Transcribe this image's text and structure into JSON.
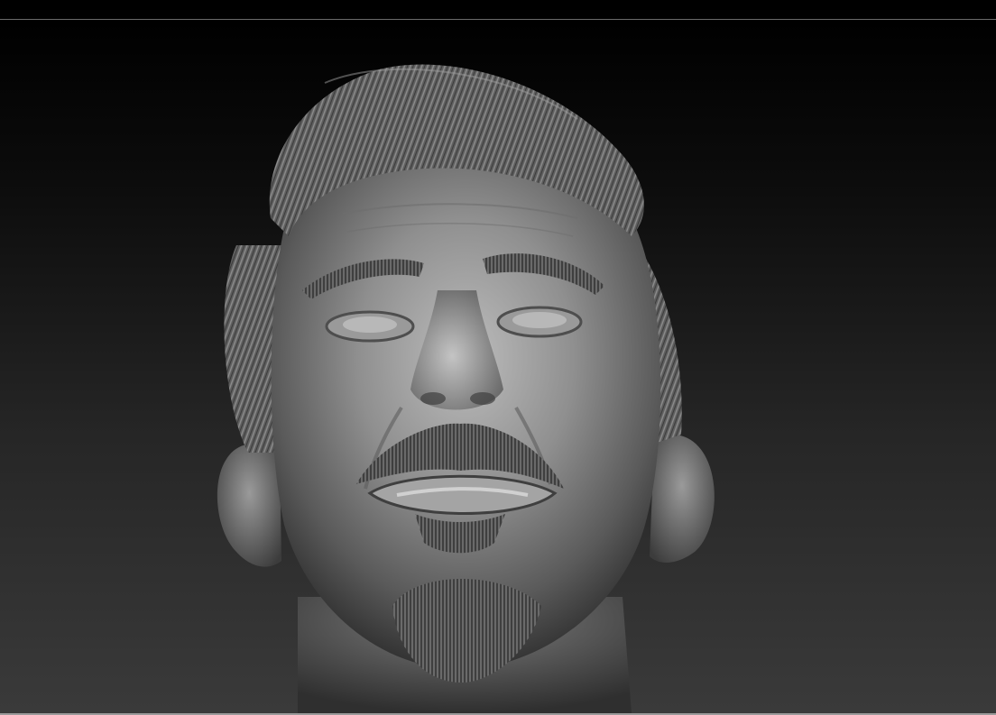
{
  "viewport": {
    "subject": "sculpted-head-mesh",
    "material_color": "#8c8c8c",
    "background_top": "#000000",
    "background_bottom": "#3a3a3a"
  }
}
